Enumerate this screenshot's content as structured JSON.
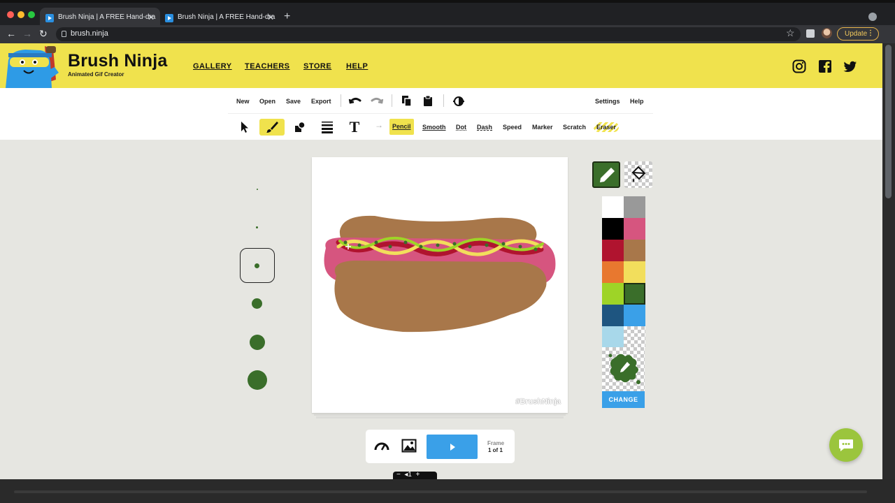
{
  "browser": {
    "tabs": [
      {
        "title": "Brush Ninja | A FREE Hand-dra",
        "close": "✕"
      },
      {
        "title": "Brush Ninja | A FREE Hand-dra",
        "close": "✕"
      }
    ],
    "new_tab": "+",
    "url": "brush.ninja",
    "update_label": "Update",
    "menu_glyph": "⋮",
    "nav": {
      "back": "←",
      "forward": "→",
      "reload": "↻",
      "bookmark": "☆"
    }
  },
  "site": {
    "brand_title": "Brush Ninja",
    "brand_subtitle": "Animated Gif Creator",
    "nav": [
      "GALLERY",
      "TEACHERS",
      "STORE",
      "HELP"
    ],
    "social_icons": [
      "instagram-icon",
      "facebook-icon",
      "twitter-icon"
    ]
  },
  "toolbar": {
    "file": [
      "New",
      "Open",
      "Save",
      "Export"
    ],
    "right": [
      "Settings",
      "Help"
    ],
    "tools": [
      "select-tool",
      "brush-tool",
      "shapes-tool",
      "lines-tool",
      "text-tool"
    ],
    "text_tool_glyph": "T",
    "arrow_glyph": "→",
    "brushes": [
      "Pencil",
      "Smooth",
      "Dot",
      "Dash",
      "Speed",
      "Marker",
      "Scratch",
      "Eraser"
    ],
    "active_brush": "Pencil"
  },
  "brush_sizes": {
    "count": 6,
    "selected_index": 2,
    "color": "#3a6e2a"
  },
  "canvas": {
    "watermark": "#BrushNinja"
  },
  "palette": {
    "colors": [
      "#ffffff",
      "#999999",
      "#000000",
      "#d6557f",
      "#b0142f",
      "#a8774a",
      "#e8782f",
      "#f2de5c",
      "#9ed427",
      "#3a6e2a",
      "#1e5580",
      "#3aa0e8",
      "#a8d8ea",
      "checker"
    ],
    "selected_color": "#3a6e2a",
    "change_label": "CHANGE"
  },
  "playback": {
    "frame_label": "Frame",
    "frame_value": "1 of 1",
    "mini_controls": "−  ◂1  +"
  }
}
